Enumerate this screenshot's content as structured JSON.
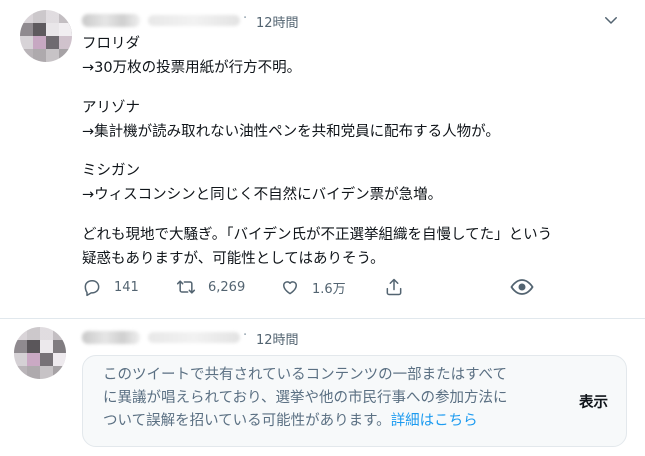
{
  "tweets": [
    {
      "dot": "·",
      "time": "12時間",
      "body": [
        "フロリダ",
        "→30万枚の投票用紙が行方不明。",
        "アリゾナ",
        "→集計機が読み取れない油性ペンを共和党員に配布する人物が。",
        "ミシガン",
        "→ウィスコンシンと同じく不自然にバイデン票が急増。",
        "どれも現地で大騒ぎ。「バイデン氏が不正選挙組織を自慢してた」という",
        "疑惑もありますが、可能性としてはありそう。"
      ],
      "actions": {
        "reply_count": "141",
        "retweet_count": "6,269",
        "like_count": "1.6万"
      }
    },
    {
      "dot": "·",
      "time": "12時間",
      "notice": {
        "line1": "このツイートで共有されているコンテンツの一部またはすべて",
        "line2": "に異議が唱えられており、選挙や他の市民行事への参加方法に",
        "line3_prefix": "ついて誤解を招いている可能性があります。",
        "link": "詳細はこちら",
        "show_button": "表示"
      }
    }
  ],
  "icons": [
    "reply-icon",
    "retweet-icon",
    "like-icon",
    "share-icon",
    "view-icon",
    "chevron-down-icon"
  ],
  "colors": {
    "text": "#0f1419",
    "secondary": "#536471",
    "link": "#1d9bf0",
    "notice_bg": "#f7f9fa"
  }
}
